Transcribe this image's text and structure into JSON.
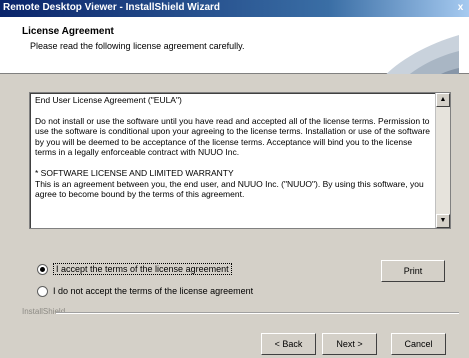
{
  "window": {
    "title": "Remote Desktop Viewer - InstallShield Wizard",
    "close_label": "x"
  },
  "header": {
    "title": "License Agreement",
    "subtitle": "Please read the following license agreement carefully."
  },
  "license": {
    "paragraphs": [
      "End User License Agreement (\"EULA\")",
      "Do not install or use the software until you have read and accepted all of the license terms. Permission to use the software is conditional upon your agreeing to the license terms. Installation or use of the software by you will be deemed to be acceptance of the license terms. Acceptance will bind you to the license terms in a legally enforceable contract with NUUO Inc.",
      "* SOFTWARE LICENSE AND LIMITED WARRANTY",
      "This is an agreement between you, the end user, and NUUO Inc. (\"NUUO\"). By using this software, you agree to become bound by the terms of this agreement."
    ]
  },
  "options": {
    "accept_label": "I accept the terms of the license agreement",
    "decline_label": "I do not accept the terms of the license agreement",
    "selected": "accept"
  },
  "buttons": {
    "print": "Print",
    "back": "< Back",
    "next": "Next >",
    "cancel": "Cancel"
  },
  "footer": {
    "brand": "InstallShield"
  }
}
